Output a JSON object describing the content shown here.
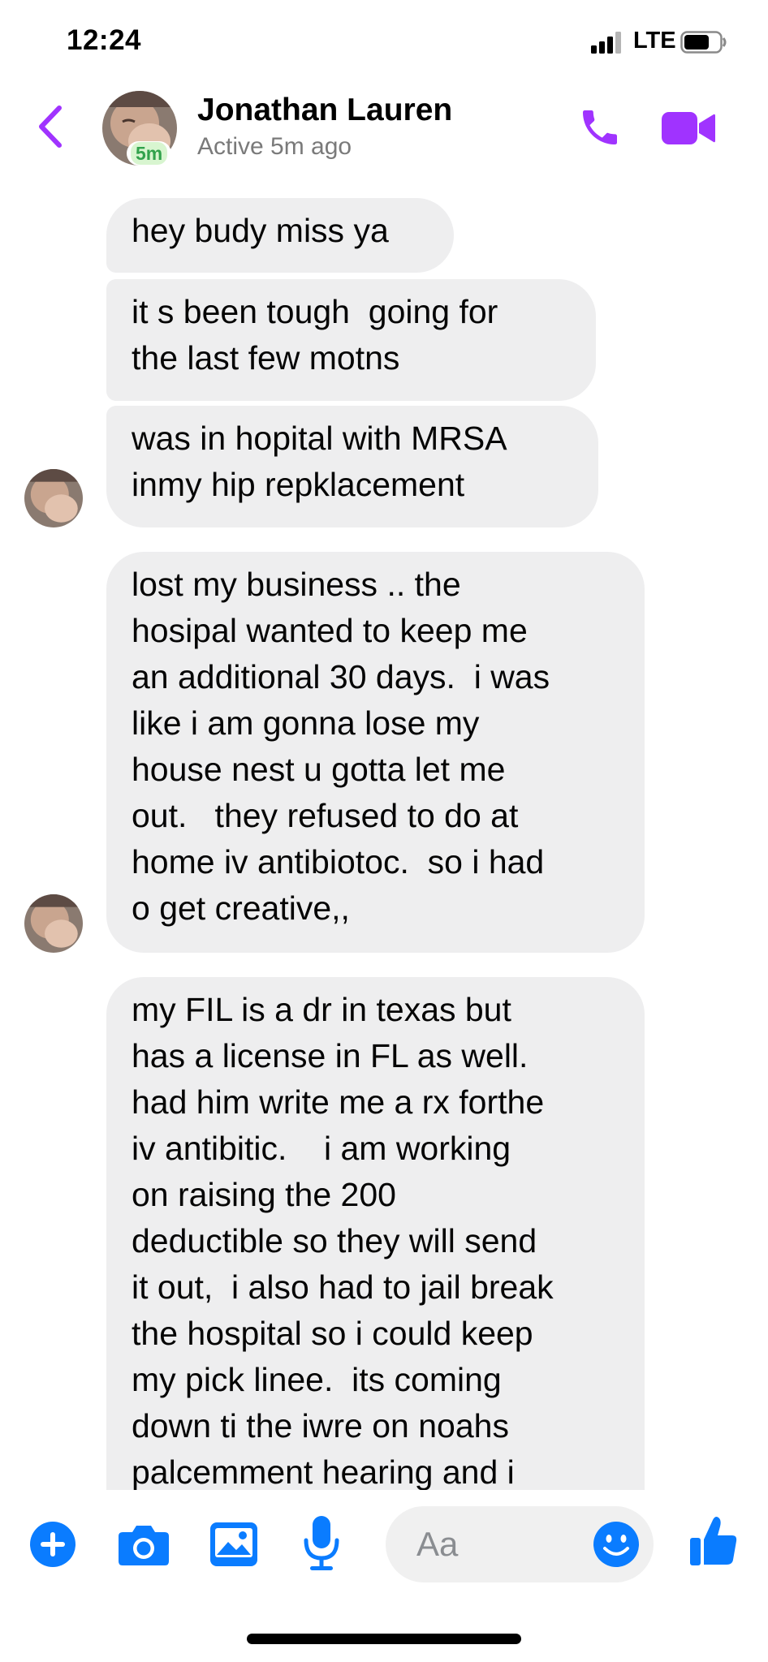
{
  "status_bar": {
    "time": "12:24",
    "network": "LTE",
    "signal_icon": "signal-bars-icon",
    "battery_icon": "battery-icon"
  },
  "header": {
    "back_icon": "chevron-left-icon",
    "contact_name": "Jonathan Lauren",
    "contact_status": "Active 5m ago",
    "active_badge": "5m",
    "call_icon": "phone-icon",
    "video_icon": "video-camera-icon",
    "accent_color": "#a033ff"
  },
  "messages": [
    {
      "text": "hey budy miss ya"
    },
    {
      "text": "it s been tough  going for\nthe last few motns"
    },
    {
      "text": "was in hopital with MRSA\ninmy hip repklacement"
    },
    {
      "text": "lost my business .. the\nhosipal wanted to keep me\nan additional 30 days.  i was\nlike i am gonna lose my\nhouse nest u gotta let me\nout.   they refused to do at\nhome iv antibiotoc.  so i had\no get creative,,"
    },
    {
      "text": "my FIL is a dr in texas but\nhas a license in FL as well.\nhad him write me a rx forthe\niv antibitic.    i am working\non raising the 200\ndeductible so they will send\nit out,  i also had to jail break\nthe hospital so i could keep\nmy pick linee.  its coming\ndown ti the iwre on noahs\npalcemment hearing and i"
    }
  ],
  "composer": {
    "placeholder": "Aa",
    "plus_icon": "plus-circle-icon",
    "camera_icon": "camera-icon",
    "gallery_icon": "image-icon",
    "mic_icon": "microphone-icon",
    "emoji_icon": "emoji-icon",
    "like_icon": "thumbs-up-icon",
    "accent_color": "#0a7cff"
  },
  "bubble_color": "#eeeeef"
}
